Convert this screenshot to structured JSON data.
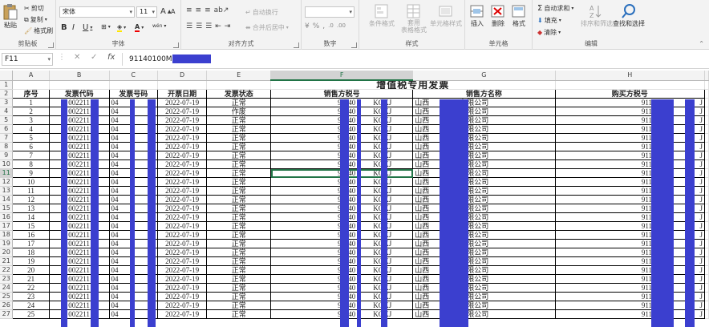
{
  "ribbon": {
    "clipboard": {
      "paste": "粘贴",
      "cut": "剪切",
      "copy": "复制",
      "format_painter": "格式刷",
      "label": "剪贴板"
    },
    "font": {
      "name": "宋体",
      "size": "11",
      "label": "字体",
      "grow": "A",
      "shrink": "A",
      "bold": "B",
      "italic": "I",
      "underline": "U",
      "wen": "wén"
    },
    "alignment": {
      "wrap": "自动换行",
      "merge": "合并后居中",
      "label": "对齐方式"
    },
    "number": {
      "label": "数字",
      "percent": "%",
      "comma": ","
    },
    "styles": {
      "conditional": "条件格式",
      "table_format": "套用\n表格格式",
      "cell_styles": "单元格样式",
      "label": "样式"
    },
    "cells": {
      "insert": "插入",
      "delete": "删除",
      "format": "格式",
      "label": "单元格"
    },
    "editing": {
      "autosum": "自动求和",
      "fill": "填充",
      "clear": "清除",
      "sort": "排序和筛选",
      "find": "查找和选择",
      "label": "编辑"
    }
  },
  "formula_bar": {
    "name_box": "F11",
    "cancel": "✕",
    "enter": "✓",
    "fx": "fx",
    "value": "91140100M"
  },
  "columns": [
    "A",
    "B",
    "C",
    "D",
    "E",
    "F",
    "G",
    "H"
  ],
  "selected_column": "F",
  "selected_row": 11,
  "sheet": {
    "title": "增值税专用发票",
    "headers": [
      "序号",
      "发票代码",
      "发票号码",
      "开票日期",
      "发票状态",
      "销售方税号",
      "销售方名称",
      "购买方税号"
    ],
    "rows": [
      [
        "1",
        "002211",
        "04",
        "2022-07-19",
        "正常",
        "91140",
        "KQKJ",
        "山西",
        "有限公司",
        "911409",
        "J"
      ],
      [
        "2",
        "002211",
        "04",
        "2022-07-19",
        "作废",
        "91140",
        "KQKJ",
        "山西",
        "有限公司",
        "911409",
        "J"
      ],
      [
        "3",
        "002211",
        "04",
        "2022-07-19",
        "正常",
        "91140",
        "KQKJ",
        "山西",
        "有限公司",
        "911409",
        "J"
      ],
      [
        "4",
        "002211",
        "04",
        "2022-07-19",
        "正常",
        "91140",
        "KQKJ",
        "山西",
        "有限公司",
        "911409",
        "J"
      ],
      [
        "5",
        "002211",
        "04",
        "2022-07-19",
        "正常",
        "91140",
        "KQKJ",
        "山西",
        "有限公司",
        "911409",
        "J"
      ],
      [
        "6",
        "002211",
        "04",
        "2022-07-19",
        "正常",
        "91140",
        "KQKJ",
        "山西",
        "有限公司",
        "911409",
        "J"
      ],
      [
        "7",
        "002211",
        "04",
        "2022-07-19",
        "正常",
        "91140",
        "KQKJ",
        "山西",
        "有限公司",
        "911409",
        "J"
      ],
      [
        "8",
        "002211",
        "04",
        "2022-07-19",
        "正常",
        "91140",
        "KQKJ",
        "山西",
        "有限公司",
        "911409",
        "J"
      ],
      [
        "9",
        "002211",
        "04",
        "2022-07-19",
        "正常",
        "91140",
        "KQKJ",
        "山西",
        "有限公司",
        "911409",
        "J"
      ],
      [
        "10",
        "002211",
        "04",
        "2022-07-19",
        "正常",
        "91140",
        "KQKJ",
        "山西",
        "有限公司",
        "911409",
        "J"
      ],
      [
        "11",
        "002211",
        "04",
        "2022-07-19",
        "正常",
        "91140",
        "KQKJ",
        "山西",
        "有限公司",
        "911409",
        "J"
      ],
      [
        "12",
        "002211",
        "04",
        "2022-07-19",
        "正常",
        "91140",
        "KQKJ",
        "山西",
        "有限公司",
        "911409",
        "J"
      ],
      [
        "13",
        "002211",
        "04",
        "2022-07-19",
        "正常",
        "91140",
        "KQKJ",
        "山西",
        "有限公司",
        "911409",
        "J"
      ],
      [
        "14",
        "002211",
        "04",
        "2022-07-19",
        "正常",
        "91140",
        "KQKJ",
        "山西",
        "有限公司",
        "911409",
        "J"
      ],
      [
        "15",
        "002211",
        "04",
        "2022-07-19",
        "正常",
        "91140",
        "KQKJ",
        "山西",
        "有限公司",
        "911409",
        "J"
      ],
      [
        "16",
        "002211",
        "04",
        "2022-07-19",
        "正常",
        "91140",
        "KQKJ",
        "山西",
        "有限公司",
        "911409",
        "J"
      ],
      [
        "17",
        "002211",
        "04",
        "2022-07-19",
        "正常",
        "91140",
        "KQKJ",
        "山西",
        "有限公司",
        "911409",
        "J"
      ],
      [
        "18",
        "002211",
        "04",
        "2022-07-19",
        "正常",
        "91140",
        "KQKJ",
        "山西",
        "有限公司",
        "911409",
        "J"
      ],
      [
        "19",
        "002211",
        "04",
        "2022-07-19",
        "正常",
        "91140",
        "KQKJ",
        "山西",
        "有限公司",
        "911409",
        "J"
      ],
      [
        "20",
        "002211",
        "04",
        "2022-07-19",
        "正常",
        "91140",
        "KQKJ",
        "山西",
        "有限公司",
        "911409",
        "J"
      ],
      [
        "21",
        "002211",
        "04",
        "2022-07-19",
        "正常",
        "91140",
        "KQKJ",
        "山西",
        "有限公司",
        "911409",
        "J"
      ],
      [
        "22",
        "002211",
        "04",
        "2022-07-19",
        "正常",
        "91140",
        "KQKJ",
        "山西",
        "有限公司",
        "911409",
        "J"
      ],
      [
        "23",
        "002211",
        "04",
        "2022-07-19",
        "正常",
        "91140",
        "KQKJ",
        "山西",
        "有限公司",
        "911409",
        "J"
      ],
      [
        "24",
        "002211",
        "04",
        "2022-07-19",
        "正常",
        "91140",
        "KQKJ",
        "山西",
        "有限公司",
        "911409",
        "J"
      ],
      [
        "25",
        "002211",
        "04",
        "2022-07-19",
        "正常",
        "91140",
        "KQKJ",
        "山西",
        "有限公司",
        "911409",
        "J"
      ]
    ]
  },
  "colors": {
    "accent": "#217346",
    "redaction": "#3b3fcf"
  }
}
